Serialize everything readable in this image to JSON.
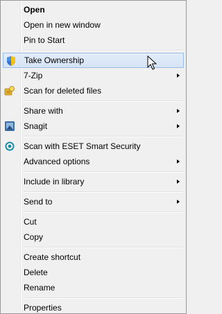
{
  "menu": {
    "items": [
      {
        "label": "Open",
        "bold": true
      },
      {
        "label": "Open in new window"
      },
      {
        "label": "Pin to Start"
      },
      {
        "separator": true
      },
      {
        "label": "Take Ownership",
        "icon": "uac-shield-icon",
        "selected": true
      },
      {
        "label": "7-Zip",
        "submenu": true
      },
      {
        "label": "Scan for deleted files",
        "icon": "recovery-icon"
      },
      {
        "separator": true
      },
      {
        "label": "Share with",
        "submenu": true
      },
      {
        "label": "Snagit",
        "icon": "snagit-icon",
        "submenu": true
      },
      {
        "separator": true
      },
      {
        "label": "Scan with ESET Smart Security",
        "icon": "eset-icon"
      },
      {
        "label": "Advanced options",
        "submenu": true
      },
      {
        "separator": true
      },
      {
        "label": "Include in library",
        "submenu": true
      },
      {
        "separator": true
      },
      {
        "label": "Send to",
        "submenu": true
      },
      {
        "separator": true
      },
      {
        "label": "Cut"
      },
      {
        "label": "Copy"
      },
      {
        "separator": true
      },
      {
        "label": "Create shortcut"
      },
      {
        "label": "Delete"
      },
      {
        "label": "Rename"
      },
      {
        "separator": true
      },
      {
        "label": "Properties"
      }
    ],
    "colors": {
      "background": "#f0f0f0",
      "selected_border": "#99bce8",
      "selected_fill": "#dbe8f8"
    }
  }
}
